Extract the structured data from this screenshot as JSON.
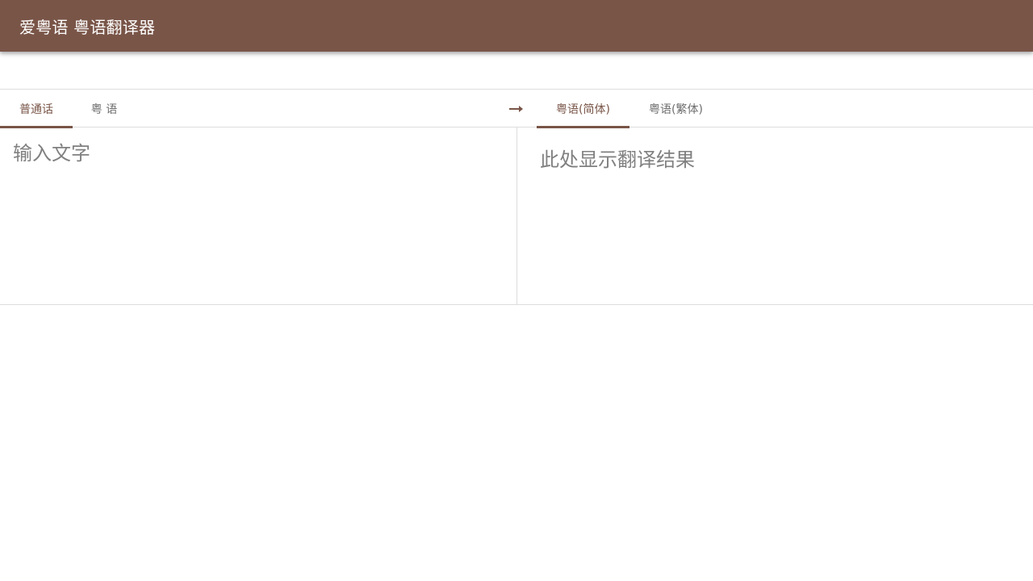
{
  "app": {
    "title": "爱粤语 粤语翻译器",
    "accent_color": "#795548"
  },
  "source_tabs": [
    {
      "label": "普通话",
      "active": true
    },
    {
      "label": "粤 语",
      "active": false
    }
  ],
  "swap_icon": "right-arrow-icon",
  "target_tabs": [
    {
      "label": "粤语(简体)",
      "active": true
    },
    {
      "label": "粤语(繁体)",
      "active": false
    }
  ],
  "input": {
    "placeholder": "输入文字",
    "value": ""
  },
  "output": {
    "placeholder": "此处显示翻译结果"
  }
}
